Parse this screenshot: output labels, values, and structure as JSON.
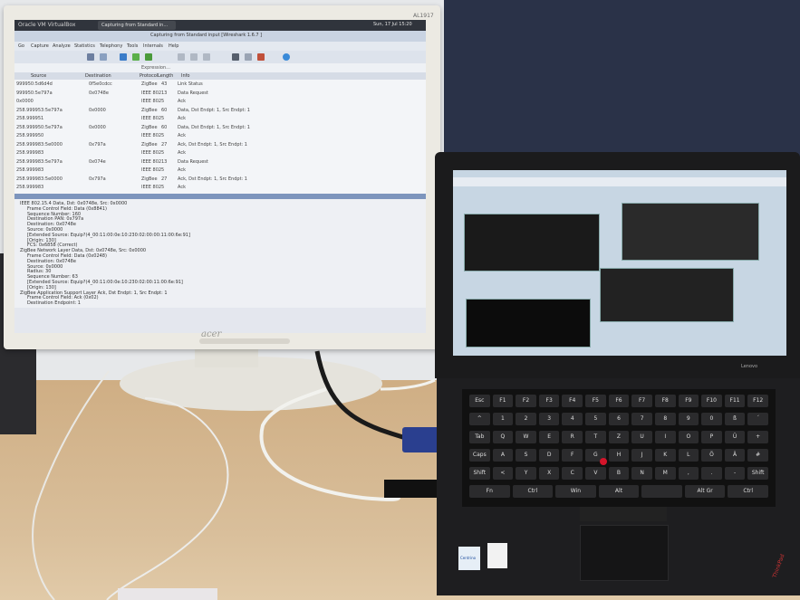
{
  "monitor": {
    "brand": "acer",
    "model": "AL1917"
  },
  "virtualbox": {
    "title": "Oracle VM VirtualBox",
    "tab": "Capturing from Standard in...",
    "clock": "Sun, 17 Jul 15:20"
  },
  "wireshark": {
    "window_title": "Capturing from Standard input [Wireshark 1.6.7 ]",
    "menu": [
      "Go",
      "Capture",
      "Analyze",
      "Statistics",
      "Telephony",
      "Tools",
      "Internals",
      "Help"
    ],
    "filter_label": "Expression...",
    "columns": [
      "Source",
      "Destination",
      "Protocol",
      "Length",
      "Info"
    ],
    "packets": [
      {
        "source": "999950:5d6d4d",
        "destination": "0f5e0cdcc",
        "protocol": "ZigBee",
        "length": "43",
        "info": "Link Status"
      },
      {
        "source": "999950:5e797a",
        "destination": "0x0748e",
        "protocol": "IEEE 802",
        "length": "13",
        "info": "Data Request"
      },
      {
        "source": "0x0000",
        "destination": "",
        "protocol": "IEEE 802",
        "length": "5",
        "info": "Ack"
      },
      {
        "source": "258.999953:5e797a",
        "destination": "0x0000",
        "protocol": "ZigBee",
        "length": "60",
        "info": "Data, Dst Endpt: 1, Src Endpt: 1"
      },
      {
        "source": "258.999951",
        "destination": "",
        "protocol": "IEEE 802",
        "length": "5",
        "info": "Ack"
      },
      {
        "source": "258.999950:5e797a",
        "destination": "0x0000",
        "protocol": "ZigBee",
        "length": "60",
        "info": "Data, Dst Endpt: 1, Src Endpt: 1"
      },
      {
        "source": "258.999950",
        "destination": "",
        "protocol": "IEEE 802",
        "length": "5",
        "info": "Ack"
      },
      {
        "source": "258.999983:5e0000",
        "destination": "0x797a",
        "protocol": "ZigBee",
        "length": "27",
        "info": "Ack, Dst Endpt: 1, Src Endpt: 1"
      },
      {
        "source": "258.999983",
        "destination": "",
        "protocol": "IEEE 802",
        "length": "5",
        "info": "Ack"
      },
      {
        "source": "258.999983:5e797a",
        "destination": "0x074e",
        "protocol": "IEEE 802",
        "length": "13",
        "info": "Data Request"
      },
      {
        "source": "258.999983",
        "destination": "",
        "protocol": "IEEE 802",
        "length": "5",
        "info": "Ack"
      },
      {
        "source": "258.999983:5e0000",
        "destination": "0x797a",
        "protocol": "ZigBee",
        "length": "27",
        "info": "Ack, Dst Endpt: 1, Src Endpt: 1"
      },
      {
        "source": "258.999983",
        "destination": "",
        "protocol": "IEEE 802",
        "length": "5",
        "info": "Ack"
      }
    ],
    "details": [
      "IEEE 802.15.4 Data, Dst: 0x0748e, Src: 0x0000",
      "Frame Control Field: Data (0x8841)",
      "Sequence Number: 160",
      "Destination PAN: 0x797a",
      "Destination: 0x0748e",
      "Source: 0x0000",
      "[Extended Source: Equip?(4_00:11:00:0e:10:230:02:00:00:11:00:6e:91]",
      "[Origin: 130]",
      "FCS: 0x6858 (Correct)",
      "ZigBee Network Layer Data, Dst: 0x0748e, Src: 0x0000",
      "Frame Control Field: Data (0x0248)",
      "Destination: 0x0748e",
      "Source: 0x0000",
      "Radius: 30",
      "Sequence Number: 63",
      "[Extended Source: Equip?(4_00:11:00:0e:10:230:02:00:11:00:6e:91]",
      "[Origin: 130]",
      "ZigBee Application Support Layer Ack, Dst Endpt: 1, Src Endpt: 1",
      "Frame Control Field: Ack (0x02)",
      "Destination Endpoint: 1"
    ]
  },
  "laptop": {
    "brand": "Lenovo",
    "logo": "ThinkPad",
    "sticker_intel": "Centrino"
  },
  "keyboard": {
    "rows": [
      [
        "Esc",
        "F1",
        "F2",
        "F3",
        "F4",
        "F5",
        "F6",
        "F7",
        "F8",
        "F9",
        "F10",
        "F11",
        "F12"
      ],
      [
        "^",
        "1",
        "2",
        "3",
        "4",
        "5",
        "6",
        "7",
        "8",
        "9",
        "0",
        "ß",
        "´"
      ],
      [
        "Tab",
        "Q",
        "W",
        "E",
        "R",
        "T",
        "Z",
        "U",
        "I",
        "O",
        "P",
        "Ü",
        "+"
      ],
      [
        "Caps",
        "A",
        "S",
        "D",
        "F",
        "G",
        "H",
        "J",
        "K",
        "L",
        "Ö",
        "Ä",
        "#"
      ],
      [
        "Shift",
        "<",
        "Y",
        "X",
        "C",
        "V",
        "B",
        "N",
        "M",
        ",",
        ".",
        "-",
        "Shift"
      ],
      [
        "Fn",
        "Ctrl",
        "Win",
        "Alt",
        "",
        "Alt Gr",
        "Ctrl"
      ]
    ]
  },
  "colors": {
    "desk": "#d3b68f",
    "monitor_bezel": "#eceae3",
    "laptop_body": "#1e1e20",
    "trackpoint": "#d4142a",
    "vga_connector": "#2a3f8f"
  }
}
